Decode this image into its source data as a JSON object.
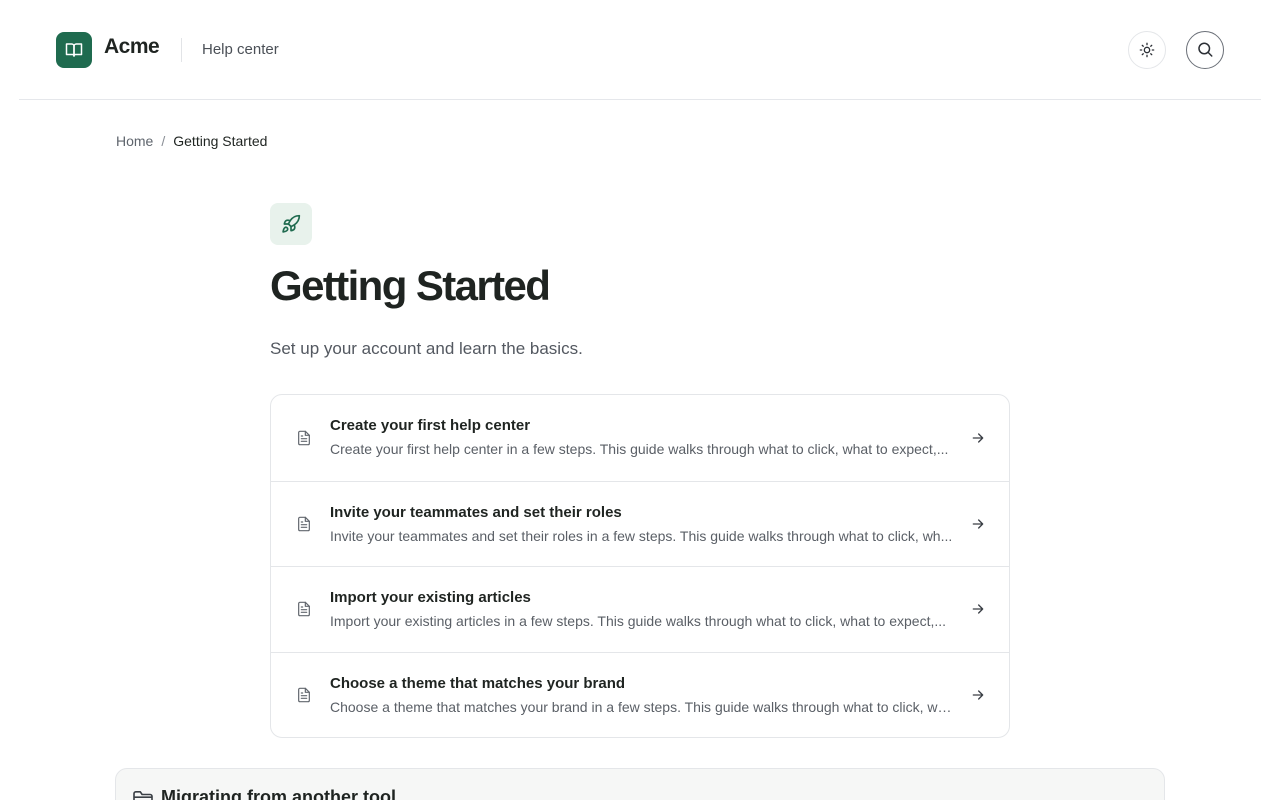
{
  "header": {
    "brand": "Acme",
    "help_link": "Help center",
    "icons": {
      "logo": "book-icon",
      "theme": "sun-icon",
      "search": "search-icon"
    }
  },
  "breadcrumb": {
    "home": "Home",
    "separator": "/",
    "current": "Getting Started"
  },
  "category": {
    "icon": "rocket-icon",
    "title": "Getting Started",
    "description": "Set up your account and learn the basics."
  },
  "articles": [
    {
      "title": "Create your first help center",
      "excerpt": "Create your first help center in a few steps. This guide walks through what to click, what to expect,..."
    },
    {
      "title": "Invite your teammates and set their roles",
      "excerpt": "Invite your teammates and set their roles in a few steps. This guide walks through what to click, wh..."
    },
    {
      "title": "Import your existing articles",
      "excerpt": "Import your existing articles in a few steps. This guide walks through what to click, what to expect,..."
    },
    {
      "title": "Choose a theme that matches your brand",
      "excerpt": "Choose a theme that matches your brand in a few steps. This guide walks through what to click, wh..."
    }
  ],
  "next_section": {
    "icon": "folder-icon",
    "title": "Migrating from another tool"
  },
  "colors": {
    "brand": "#1f6b4f",
    "brand_tint": "#e8f2ec",
    "text": "#1f2421",
    "muted": "#5a5f66",
    "border": "#e4e6e9"
  }
}
